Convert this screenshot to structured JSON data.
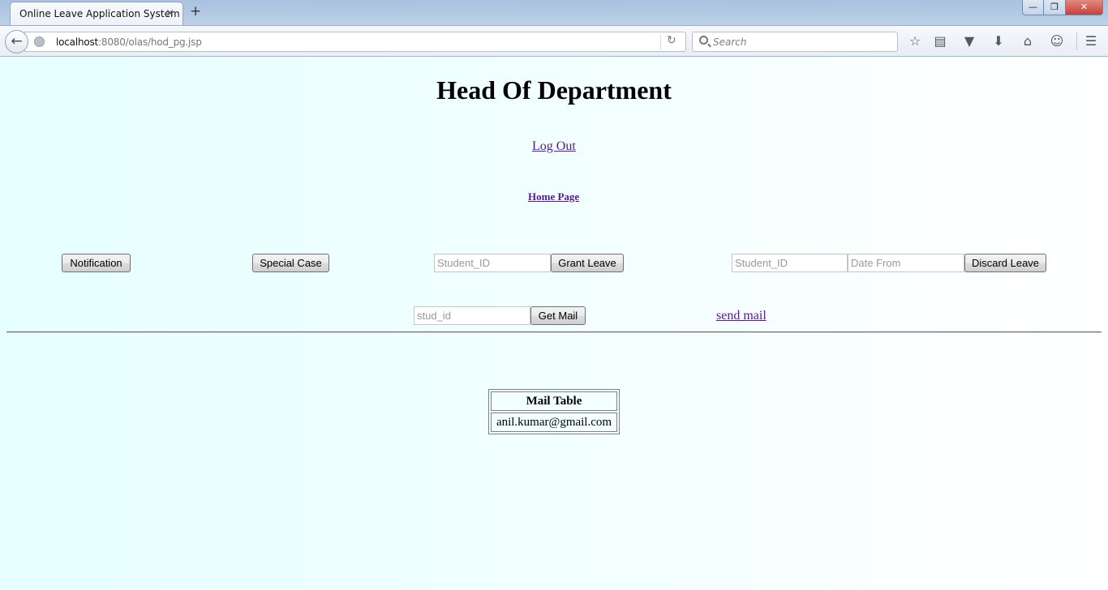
{
  "browser": {
    "tab_title": "Online Leave Application System",
    "tab_close": "×",
    "new_tab": "+",
    "url_host": "localhost",
    "url_rest": ":8080/olas/hod_pg.jsp",
    "search_placeholder": "Search",
    "window_controls": {
      "minimize": "—",
      "maximize": "❐",
      "close": "✕"
    }
  },
  "page": {
    "title": "Head Of Department",
    "logout_label": "Log Out",
    "home_label": "Home Page",
    "notification_button": "Notification",
    "special_case_button": "Special Case",
    "grant": {
      "student_id_placeholder": "Student_ID",
      "button": "Grant Leave"
    },
    "discard": {
      "student_id_placeholder": "Student_ID",
      "date_from_placeholder": "Date From",
      "button": "Discard Leave"
    },
    "mail": {
      "stud_id_placeholder": "stud_id",
      "get_mail_button": "Get Mail",
      "send_mail_label": "send mail"
    },
    "mail_table": {
      "header": "Mail Table",
      "rows": [
        "anil.kumar@gmail.com"
      ]
    }
  }
}
